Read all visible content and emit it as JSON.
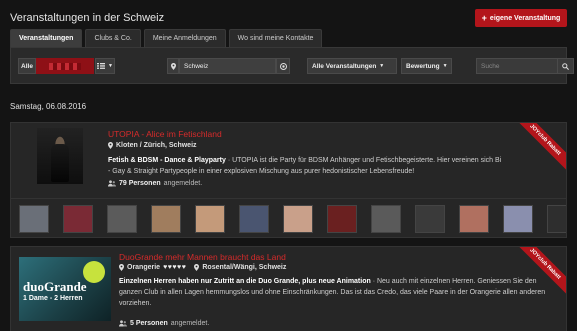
{
  "header": {
    "title": "Veranstaltungen in der Schweiz",
    "new_event_label": "eigene Veranstaltung"
  },
  "tabs": [
    {
      "label": "Veranstaltungen",
      "active": true
    },
    {
      "label": "Clubs & Co."
    },
    {
      "label": "Meine Anmeldungen"
    },
    {
      "label": "Wo sind meine Kontakte"
    }
  ],
  "filters": {
    "all_label": "Alle",
    "location_value": "Schweiz",
    "events_dropdown": "Alle Veranstaltungen",
    "rating_dropdown": "Bewertung",
    "search_placeholder": "Suche"
  },
  "date_heading": "Samstag, 06.08.2016",
  "events": [
    {
      "title": "UTOPIA - Alice im Fetischland",
      "location": "Kloten / Zürich, Schweiz",
      "desc_bold": "Fetish & BDSM - Dance & Playparty",
      "desc": " · UTOPIA ist die Party für BDSM Anhänger und Fetischbegeisterte. Hier vereinen sich Bi - Gay & Straight Partypeople in einer explosiven Mischung aus purer hedonistischer Lebensfreude!",
      "people_count": "79 Personen",
      "people_suffix": "angemeldet.",
      "ribbon": "JOYclub Rabatt"
    },
    {
      "title": "DuoGrande mehr Mannen braucht das Land",
      "venue": "Orangerie",
      "hearts": "♥♥♥♥♥",
      "location": "Rosental/Wängi, Schweiz",
      "desc_bold": "Einzelnen Herren haben nur Zutritt an die Duo Grande, plus neue Animation",
      "desc": " · Neu auch mit einzelnen Herren. Geniessen Sie den ganzen Club in allen Lagen hemmungslos und ohne Einschränkungen. Das ist das Credo, das viele Paare in der Orangerie allen anderen vorziehen.",
      "people_count": "5 Personen",
      "people_suffix": "angemeldet.",
      "ribbon": "JOYclub Rabatt",
      "thumb_text_1": "duoGrande",
      "thumb_text_2": "1 Dame - 2 Herren"
    }
  ],
  "avatar_colors": [
    "#6a6f78",
    "#7a2a35",
    "#5b5b5b",
    "#a07d5e",
    "#c49a7a",
    "#4a5570",
    "#c9a08a",
    "#6a2020",
    "#5a5a5a",
    "#3a3a3a",
    "#b07060",
    "#8a8fae",
    "#2e2e2e"
  ]
}
